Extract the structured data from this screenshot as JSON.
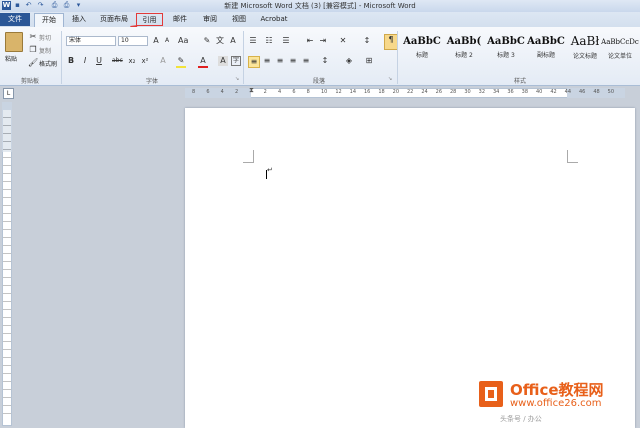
{
  "window": {
    "title": "新建 Microsoft Word 文档 (3) [兼容模式] - Microsoft Word"
  },
  "quick_access": [
    "word-icon",
    "save-icon",
    "undo-icon",
    "redo-icon",
    "print-preview-icon",
    "customize-icon"
  ],
  "tabs": {
    "file": "文件",
    "home": "开始",
    "insert": "插入",
    "layout": "页面布局",
    "references": "引用",
    "mailings": "邮件",
    "review": "审阅",
    "view": "视图",
    "acrobat": "Acrobat"
  },
  "clipboard": {
    "paste": "粘贴",
    "cut": "剪切",
    "copy": "复制",
    "format_painter": "格式刷",
    "label": "剪贴板"
  },
  "font": {
    "name": "宋体",
    "size": "10",
    "label": "字体",
    "bold": "B",
    "italic": "I",
    "underline": "U",
    "strike": "abc",
    "sub": "x₂",
    "sup": "x²"
  },
  "paragraph": {
    "label": "段落"
  },
  "styles": {
    "label": "样式",
    "items": [
      {
        "sample": "AaBbC",
        "name": "标题"
      },
      {
        "sample": "AaBb(",
        "name": "标题 2"
      },
      {
        "sample": "AaBbC",
        "name": "标题 3"
      },
      {
        "sample": "AaBbC",
        "name": "副标题"
      },
      {
        "sample": "AaBł",
        "name": "论文标题"
      },
      {
        "sample": "AaBbCcDc",
        "name": "论文单位"
      }
    ]
  },
  "ruler": {
    "ticks": [
      "8",
      "6",
      "4",
      "2",
      "",
      "2",
      "4",
      "6",
      "8",
      "10",
      "12",
      "14",
      "16",
      "18",
      "20",
      "22",
      "24",
      "26",
      "28",
      "30",
      "32",
      "34",
      "36",
      "38",
      "40",
      "42",
      "44",
      "46",
      "48",
      "50"
    ]
  },
  "document": {
    "paragraph_mark": "↵"
  },
  "watermark": {
    "title": "Office教程网",
    "url": "www.office26.com",
    "small": "头条号 / 办公"
  },
  "colors": {
    "accent": "#2b5797",
    "highlight": "#e23a3a",
    "watermark": "#e8601a"
  }
}
